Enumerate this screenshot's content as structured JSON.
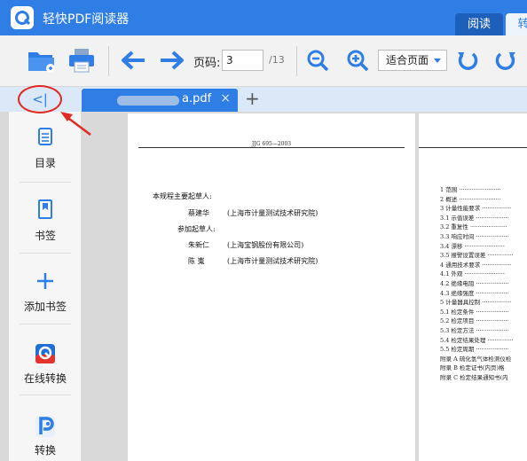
{
  "app": {
    "title": "轻快PDF阅读器"
  },
  "mode_tabs": [
    {
      "label": "阅读"
    },
    {
      "label": "转"
    }
  ],
  "toolbar": {
    "page_label": "页码:",
    "page_value": "3",
    "page_total": "/13",
    "zoom_option": "适合页面",
    "icons": [
      "open-folder-icon",
      "print-icon",
      "previous-arrow-icon",
      "next-arrow-icon",
      "zoom-out-icon",
      "zoom-in-icon",
      "rotate-left-icon",
      "rotate-right-icon"
    ]
  },
  "tabs": {
    "collapse_label": "<|",
    "document_tab": {
      "name": "a.pdf",
      "close": "×"
    },
    "new_tab": "+"
  },
  "sidebar": {
    "items": [
      {
        "label": "目录",
        "icon": "toc-icon"
      },
      {
        "label": "书签",
        "icon": "bookmark-icon"
      },
      {
        "label": "添加书签",
        "icon": "add-bookmark-icon"
      },
      {
        "label": "在线转换",
        "icon": "online-convert-icon"
      },
      {
        "label": "转换",
        "icon": "convert-icon"
      }
    ]
  },
  "document": {
    "page_header": "JJG 695—2003",
    "drafters_heading": "本规程主要起草人:",
    "drafters": [
      {
        "name": "蔡建华",
        "org": "(上海市计量测试技术研究院)"
      }
    ],
    "participants_heading": "参加起草人:",
    "participants": [
      {
        "name": "朱新仁",
        "org": "(上海宝钢股份有限公司)"
      },
      {
        "name": "陈  嵬",
        "org": "(上海市计量测试技术研究院)"
      }
    ],
    "toc": [
      "1  范围 ·······················",
      "2  概述 ·······················",
      "3  计量性能要求 ················",
      "3.1  示值误差 ··················",
      "3.2  重复性 ····················",
      "3.3  响应时间 ··················",
      "3.4  漂移 ······················",
      "3.5  报警设置误差 ··············",
      "4  通用技术要求 ················",
      "4.1  外观 ······················",
      "4.2  绝缘电阻 ··················",
      "4.3  绝缘强度 ··················",
      "5  计量器具控制 ················",
      "5.1  检定条件 ··················",
      "5.2  检定项目 ··················",
      "5.3  检定方法 ··················",
      "5.4  检定结果处理 ··············",
      "5.5  检定周期 ··················",
      "附录 A  硫化氢气体检测仪检",
      "附录 B  检定证书(内页)格",
      "附录 C  检定结果通知书(内"
    ]
  }
}
